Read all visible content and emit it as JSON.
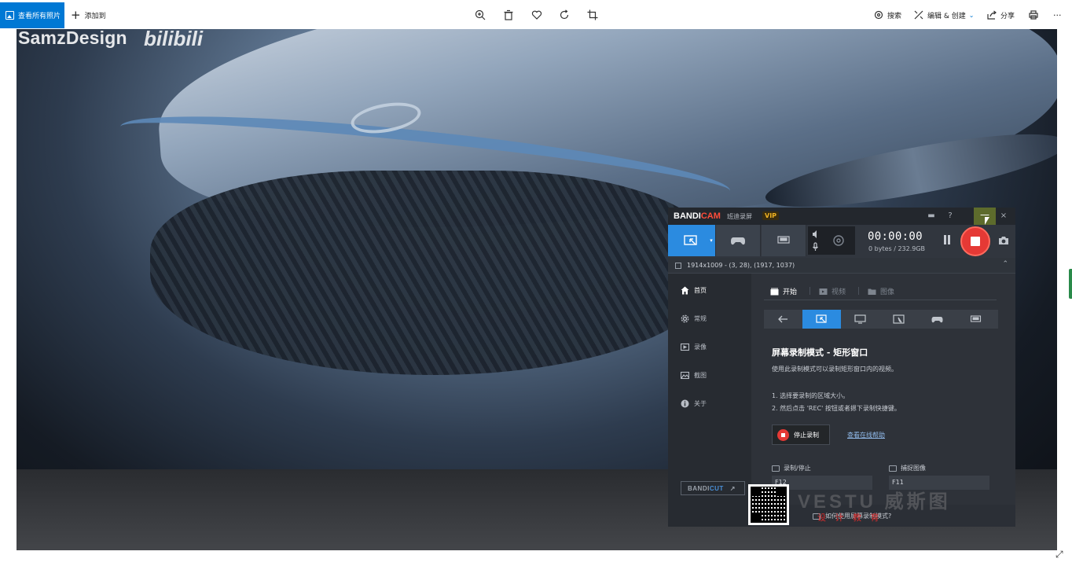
{
  "photos_app": {
    "toolbar": {
      "see_all_label": "查看所有照片",
      "add_to_label": "添加到",
      "tools": [
        "zoom-in-icon",
        "delete-icon",
        "favorite-icon",
        "rotate-icon",
        "crop-icon"
      ],
      "search_label": "搜索",
      "edit_create_label": "编辑 & 创建",
      "share_label": "分享",
      "print_icon": "print-icon",
      "more_label": "···"
    },
    "accent_color": "#0078d4"
  },
  "photo": {
    "watermark_text": "SamzDesign",
    "watermark_logo_text": "bilibili"
  },
  "bandicam": {
    "brand_main": "BANDI",
    "brand_accent": "CAM",
    "brand_sub": "班迪录屏",
    "vip_badge": "VIP",
    "title_buttons": {
      "folder": "▬",
      "help": "?",
      "minimize": "—",
      "close": "×"
    },
    "timer": "00:00:00",
    "bytes": "0 bytes / 232.9GB",
    "area_text": "1914x1009 - (3, 28), (1917, 1037)",
    "sidebar": [
      {
        "label": "首页",
        "icon": "home-icon"
      },
      {
        "label": "常规",
        "icon": "gear-icon"
      },
      {
        "label": "录像",
        "icon": "video-icon"
      },
      {
        "label": "截图",
        "icon": "image-icon"
      },
      {
        "label": "关于",
        "icon": "info-icon"
      }
    ],
    "bandicut_main": "BANDI",
    "bandicut_accent": "CUT",
    "bandicut_arrow": "↗",
    "tabs": [
      {
        "label": "开始",
        "icon": "start-icon"
      },
      {
        "label": "视频",
        "icon": "video-icon"
      },
      {
        "label": "图像",
        "icon": "folder-icon"
      }
    ],
    "mode_title": "屏幕录制模式 - 矩形窗口",
    "mode_desc": "使用此录制模式可以录制矩形窗口内的视频。",
    "step1": "1. 选择要录制的区域大小。",
    "step2": "2. 然后点击 'REC' 按钮或者摁下录制快捷键。",
    "stop_button_label": "停止录制",
    "help_link": "查看在线帮助",
    "hotkey_record_label": "录制/停止",
    "hotkey_record_value": "F12",
    "hotkey_capture_label": "捕捉图像",
    "hotkey_capture_value": "F11",
    "bottom_text": "如何使用屏幕录制模式?",
    "rec_color": "#e53935",
    "active_color": "#2b8be0"
  },
  "overlay": {
    "logo_text": "VESTU 威斯图",
    "red_text": "设 计 教 育"
  }
}
